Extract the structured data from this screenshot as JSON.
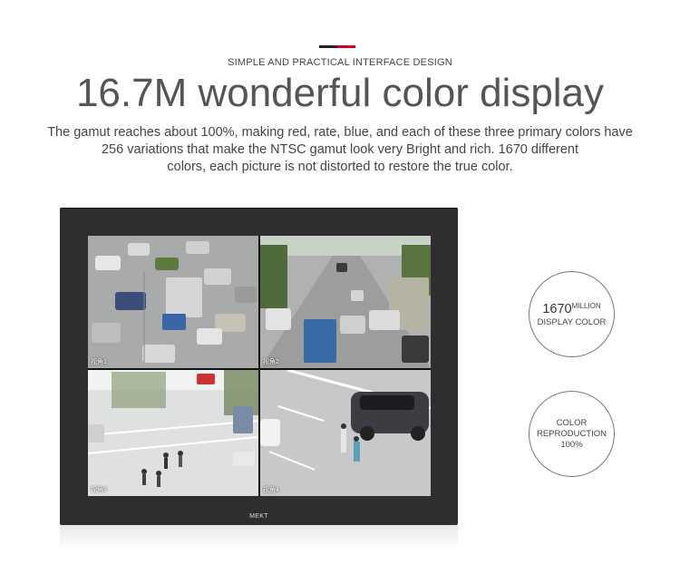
{
  "header": {
    "eyebrow": "SIMPLE AND PRACTICAL INTERFACE DESIGN",
    "title": "16.7M wonderful color display",
    "description_lines": [
      "The gamut reaches about 100%, making red, rate, blue, and each of these three primary colors have",
      "256 variations that make the NTSC gamut look very Bright and rich. 1670 different",
      "colors, each picture is not distorted to restore the true color."
    ]
  },
  "monitor": {
    "brand": "MEKT",
    "quads": [
      {
        "label": "视角1"
      },
      {
        "label": "视角2"
      },
      {
        "label": "视角3"
      },
      {
        "label": "视角4"
      }
    ]
  },
  "badges": {
    "display_color": {
      "number": "1670",
      "unit": "MILLION",
      "caption": "DISPLAY COLOR"
    },
    "reproduction": {
      "line1": "COLOR",
      "line2": "REPRODUCTION",
      "line3": "100%"
    }
  },
  "colors": {
    "accent_red": "#d0021b",
    "accent_dark": "#222222",
    "bezel": "#2e2e30"
  }
}
